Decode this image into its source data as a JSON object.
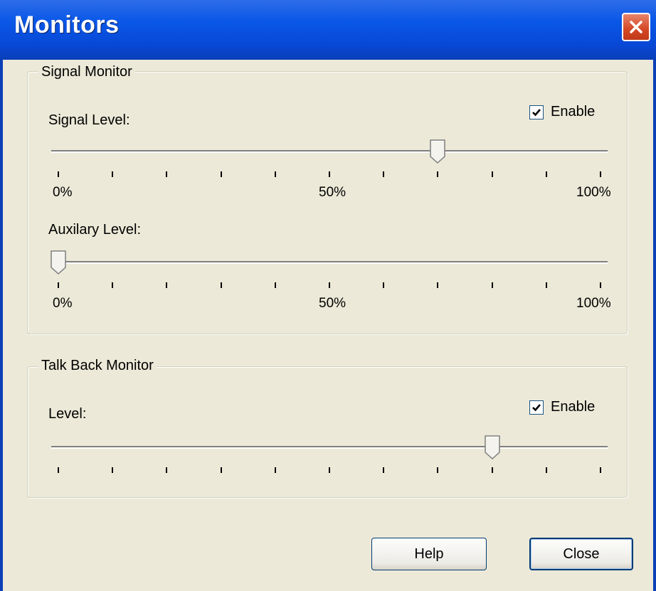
{
  "window": {
    "title": "Monitors"
  },
  "signal_monitor": {
    "group_label": "Signal Monitor",
    "enable": {
      "label": "Enable",
      "checked": true
    },
    "signal_level": {
      "label": "Signal Level:",
      "value_percent": 70
    },
    "auxiliary_level": {
      "label": "Auxilary Level:",
      "value_percent": 0
    },
    "tick_labels": {
      "min": "0%",
      "mid": "50%",
      "max": "100%"
    }
  },
  "talk_back_monitor": {
    "group_label": "Talk Back Monitor",
    "enable": {
      "label": "Enable",
      "checked": true
    },
    "level": {
      "label": "Level:",
      "value_percent": 80
    }
  },
  "buttons": {
    "help": "Help",
    "close": "Close"
  },
  "icons": {
    "close": "close-x-icon",
    "check": "checkmark-icon"
  },
  "colors": {
    "titlebar": "#0a58e8",
    "dialog_bg": "#ece9d8",
    "close_button": "#d44724"
  }
}
